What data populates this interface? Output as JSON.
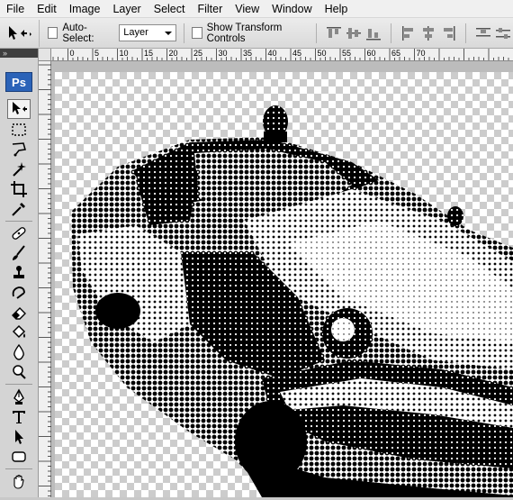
{
  "menu": [
    "File",
    "Edit",
    "Image",
    "Layer",
    "Select",
    "Filter",
    "View",
    "Window",
    "Help"
  ],
  "options": {
    "auto_select_label": "Auto-Select:",
    "auto_select_value": "Layer",
    "transform_label": "Show Transform Controls"
  },
  "app_logo": "Ps",
  "ruler_numbers": [
    "5",
    "0",
    "5",
    "10",
    "15",
    "20",
    "25",
    "30",
    "35",
    "40",
    "45",
    "50",
    "55",
    "60",
    "65",
    "70"
  ],
  "tools": [
    "move-tool",
    "marquee-tool",
    "lasso-tool",
    "magic-wand-tool",
    "crop-tool",
    "eyedropper-tool",
    "healing-brush-tool",
    "brush-tool",
    "clone-stamp-tool",
    "history-brush-tool",
    "eraser-tool",
    "paint-bucket-tool",
    "blur-tool",
    "dodge-tool",
    "pen-tool",
    "type-tool",
    "path-selection-tool",
    "shape-tool",
    "hand-tool"
  ],
  "canvas_image": "halftone-police-car"
}
